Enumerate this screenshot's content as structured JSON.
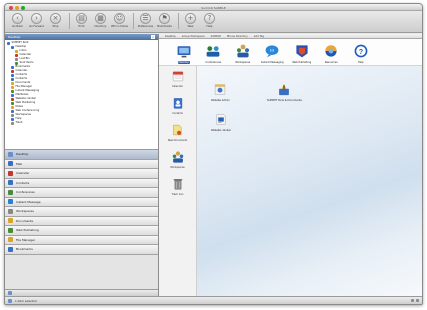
{
  "window": {
    "title": "Summit  SAMPLE",
    "traffic_colors": [
      "#e0443e",
      "#dea123",
      "#1aab29"
    ]
  },
  "toolbar": {
    "buttons": [
      {
        "label": "Go Back",
        "icon": "back-arrow-icon"
      },
      {
        "label": "Go Forward",
        "icon": "forward-arrow-icon"
      },
      {
        "label": "Stop",
        "icon": "stop-icon"
      },
      {
        "label": "Print",
        "icon": "print-icon"
      },
      {
        "label": "Directory",
        "icon": "directory-icon"
      },
      {
        "label": "Who's Online",
        "icon": "online-icon"
      },
      {
        "label": "Preferences",
        "icon": "preferences-icon"
      },
      {
        "label": "Bookmarks",
        "icon": "bookmarks-icon"
      },
      {
        "label": "New",
        "icon": "new-icon"
      },
      {
        "label": "Help",
        "icon": "help-icon"
      }
    ]
  },
  "sidebar": {
    "panel_title": "Desktop",
    "close_glyph": "x",
    "tree": [
      {
        "label": "SUMMIT Root",
        "indent": 0,
        "color": "#3b6fc4"
      },
      {
        "label": "Desktop",
        "indent": 1,
        "color": "#3b6fc4"
      },
      {
        "label": "Inbox",
        "indent": 2,
        "color": "#d9a52b"
      },
      {
        "label": "Calendar",
        "indent": 2,
        "color": "#c0392b"
      },
      {
        "label": "Lost Bin",
        "indent": 2,
        "color": "#888888"
      },
      {
        "label": "Sent Items",
        "indent": 2,
        "color": "#4a8a3c"
      },
      {
        "label": "Bookmarks",
        "indent": 1,
        "color": "#3b6fc4"
      },
      {
        "label": "Calendar",
        "indent": 1,
        "color": "#c0392b"
      },
      {
        "label": "Contacts",
        "indent": 1,
        "color": "#3b6fc4"
      },
      {
        "label": "Contacts",
        "indent": 1,
        "color": "#3b6fc4"
      },
      {
        "label": "Documents",
        "indent": 1,
        "color": "#d9a52b"
      },
      {
        "label": "File Manager",
        "indent": 1,
        "color": "#d9a52b"
      },
      {
        "label": "Instant Messaging",
        "indent": 1,
        "color": "#4a8a3c"
      },
      {
        "label": "Mailboxes",
        "indent": 1,
        "color": "#3b6fc4"
      },
      {
        "label": "Website: Global",
        "indent": 1,
        "color": "#c0392b"
      },
      {
        "label": "Web Publishing",
        "indent": 1,
        "color": "#4a8a3c"
      },
      {
        "label": "Notes",
        "indent": 1,
        "color": "#d9a52b"
      },
      {
        "label": "Web Conferencing",
        "indent": 1,
        "color": "#3b6fc4"
      },
      {
        "label": "Workspaces",
        "indent": 1,
        "color": "#888888"
      },
      {
        "label": "Help",
        "indent": 1,
        "color": "#3b6fc4"
      },
      {
        "label": "Trash",
        "indent": 1,
        "color": "#888888"
      }
    ],
    "modules": [
      {
        "label": "Desktop",
        "color": "#6b8fc7"
      },
      {
        "label": "Mail",
        "color": "#3b6fc4"
      },
      {
        "label": "Calendar",
        "color": "#c0392b"
      },
      {
        "label": "Contacts",
        "color": "#3b6fc4"
      },
      {
        "label": "Conferences",
        "color": "#4a8a3c"
      },
      {
        "label": "Instant Message",
        "color": "#2a7fd4"
      },
      {
        "label": "Workspaces",
        "color": "#888888"
      },
      {
        "label": "Documents",
        "color": "#d9a52b"
      },
      {
        "label": "Web Publishing",
        "color": "#4a8a3c"
      },
      {
        "label": "File Manager",
        "color": "#d9a52b"
      },
      {
        "label": "Bookmarks",
        "color": "#3b6fc4"
      }
    ]
  },
  "content": {
    "tabs": [
      "Desktop",
      "Group Workspace",
      "SAMPLE",
      "Phone Directory",
      "Add Tag"
    ],
    "launcher": [
      {
        "label": "Desktop",
        "icon": "desktop-icon",
        "active": true
      },
      {
        "label": "Conferences",
        "icon": "conferences-icon",
        "active": false
      },
      {
        "label": "Workspaces",
        "icon": "workspaces-icon",
        "active": false
      },
      {
        "label": "Instant Messaging",
        "icon": "instant-messaging-icon",
        "active": false
      },
      {
        "label": "Web Publishing",
        "icon": "web-publishing-icon",
        "active": false
      },
      {
        "label": "Resources",
        "icon": "resources-icon",
        "active": false
      },
      {
        "label": "Help",
        "icon": "help-icon",
        "active": false
      }
    ],
    "tools": [
      {
        "label": "Calendar",
        "icon": "calendar-icon"
      },
      {
        "label": "Contacts",
        "icon": "contacts-icon"
      },
      {
        "label": "New Documents",
        "icon": "new-documents-icon"
      },
      {
        "label": "Workspaces",
        "icon": "workspaces-icon"
      },
      {
        "label": "Trash Can",
        "icon": "trash-icon"
      }
    ],
    "desktop_items": [
      {
        "label": "Website Admin",
        "icon": "website-admin-icon"
      },
      {
        "label": "SUMMIT Tools & Documents",
        "icon": "tools-documents-icon"
      },
      {
        "label": "Website: Global",
        "icon": "website-global-icon"
      }
    ]
  },
  "status": {
    "text": "1 item selected"
  }
}
